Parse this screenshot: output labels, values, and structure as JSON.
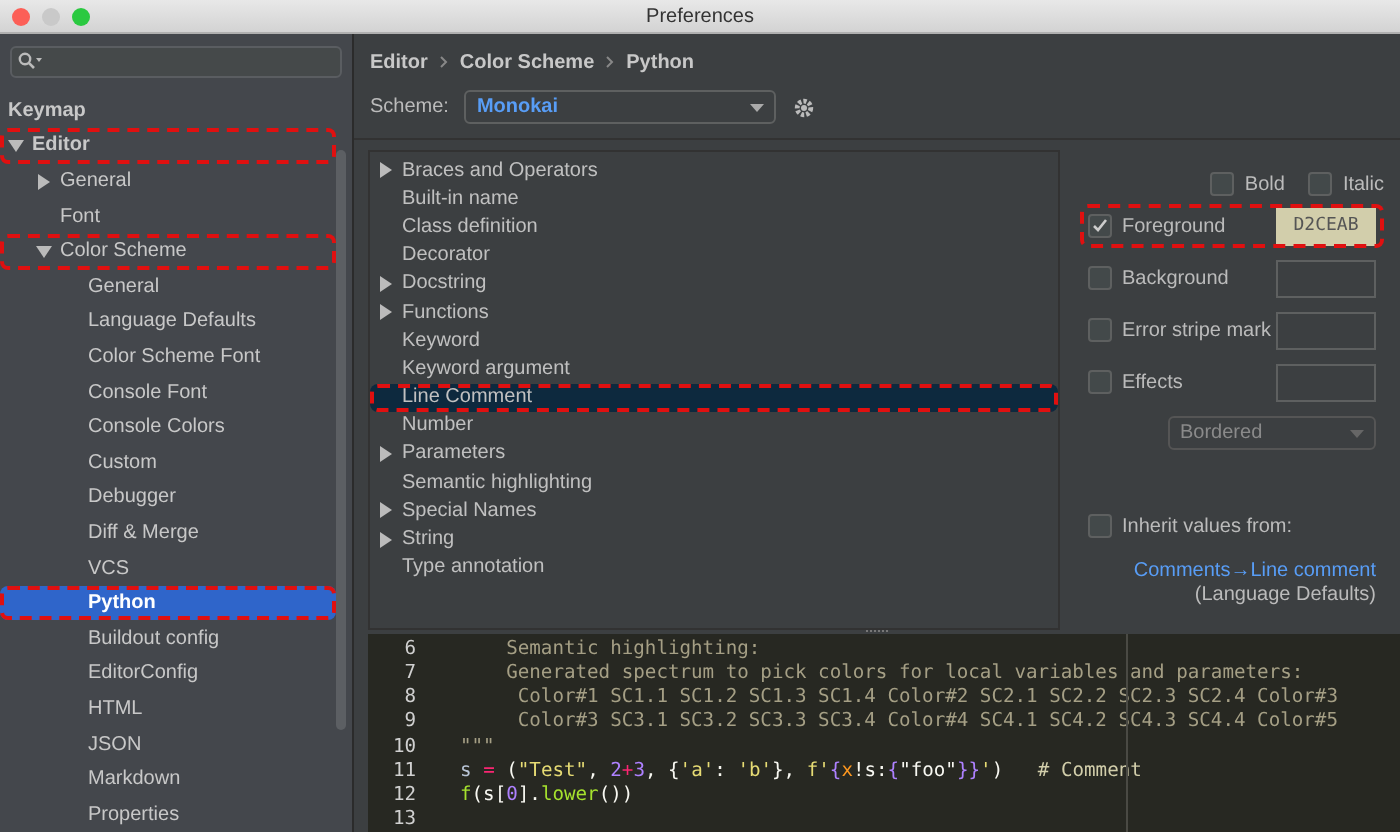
{
  "window": {
    "title": "Preferences"
  },
  "sidebar": {
    "items": [
      {
        "label": "Keymap",
        "selected": false,
        "annotated": false
      },
      {
        "label": "Editor",
        "selected": false,
        "annotated": true,
        "expanded": true,
        "children": [
          {
            "label": "General",
            "selected": false,
            "annotated": false,
            "expanded": false
          },
          {
            "label": "Font",
            "selected": false,
            "annotated": false
          },
          {
            "label": "Color Scheme",
            "selected": false,
            "annotated": true,
            "expanded": true,
            "children": [
              {
                "label": "General",
                "selected": false,
                "annotated": false
              },
              {
                "label": "Language Defaults",
                "selected": false,
                "annotated": false
              },
              {
                "label": "Color Scheme Font",
                "selected": false,
                "annotated": false
              },
              {
                "label": "Console Font",
                "selected": false,
                "annotated": false
              },
              {
                "label": "Console Colors",
                "selected": false,
                "annotated": false
              },
              {
                "label": "Custom",
                "selected": false,
                "annotated": false
              },
              {
                "label": "Debugger",
                "selected": false,
                "annotated": false
              },
              {
                "label": "Diff & Merge",
                "selected": false,
                "annotated": false
              },
              {
                "label": "VCS",
                "selected": false,
                "annotated": false
              },
              {
                "label": "Python",
                "selected": true,
                "annotated": true
              },
              {
                "label": "Buildout config",
                "selected": false,
                "annotated": false
              },
              {
                "label": "EditorConfig",
                "selected": false,
                "annotated": false
              },
              {
                "label": "HTML",
                "selected": false,
                "annotated": false
              },
              {
                "label": "JSON",
                "selected": false,
                "annotated": false
              },
              {
                "label": "Markdown",
                "selected": false,
                "annotated": false
              },
              {
                "label": "Properties",
                "selected": false,
                "annotated": false
              }
            ]
          }
        ]
      }
    ]
  },
  "breadcrumb": [
    "Editor",
    "Color Scheme",
    "Python"
  ],
  "scheme": {
    "label": "Scheme:",
    "value": "Monokai"
  },
  "attributes": [
    {
      "label": "Braces and Operators",
      "expanded": false,
      "selected": false,
      "annotated": false
    },
    {
      "label": "Built-in name",
      "selected": false,
      "annotated": false
    },
    {
      "label": "Class definition",
      "selected": false,
      "annotated": false
    },
    {
      "label": "Decorator",
      "selected": false,
      "annotated": false
    },
    {
      "label": "Docstring",
      "expanded": false,
      "selected": false,
      "annotated": false
    },
    {
      "label": "Functions",
      "expanded": false,
      "selected": false,
      "annotated": false
    },
    {
      "label": "Keyword",
      "selected": false,
      "annotated": false
    },
    {
      "label": "Keyword argument",
      "selected": false,
      "annotated": false
    },
    {
      "label": "Line Comment",
      "selected": true,
      "annotated": true
    },
    {
      "label": "Number",
      "selected": false,
      "annotated": false
    },
    {
      "label": "Parameters",
      "expanded": false,
      "selected": false,
      "annotated": false
    },
    {
      "label": "Semantic highlighting",
      "selected": false,
      "annotated": false
    },
    {
      "label": "Special Names",
      "expanded": false,
      "selected": false,
      "annotated": false
    },
    {
      "label": "String",
      "expanded": false,
      "selected": false,
      "annotated": false
    },
    {
      "label": "Type annotation",
      "selected": false,
      "annotated": false
    }
  ],
  "font_style": [
    {
      "label": "Bold",
      "checked": false
    },
    {
      "label": "Italic",
      "checked": false
    }
  ],
  "effects": [
    {
      "label": "Foreground",
      "checked": true,
      "value": "D2CEAB",
      "color": "#d2ceab",
      "annotated": true
    },
    {
      "label": "Background",
      "checked": false,
      "annotated": false
    },
    {
      "label": "Error stripe mark",
      "checked": false,
      "annotated": false
    },
    {
      "label": "Effects",
      "checked": false,
      "annotated": false
    }
  ],
  "effect_type": {
    "value": "Bordered",
    "disabled": true
  },
  "inherit": {
    "label": "Inherit values from:",
    "checked": false,
    "link": "Comments→Line comment",
    "note": "(Language Defaults)"
  },
  "code": [
    {
      "number": "6",
      "tokens": [
        {
          "text": "    Semantic highlighting:",
          "color": "#a59f85"
        }
      ]
    },
    {
      "number": "7",
      "tokens": [
        {
          "text": "    Generated spectrum to pick colors for local variables and parameters:",
          "color": "#a59f85"
        }
      ]
    },
    {
      "number": "8",
      "tokens": [
        {
          "text": "     Color#1 SC1.1 SC1.2 SC1.3 SC1.4 Color#2 SC2.1 SC2.2 SC2.3 SC2.4 Color#3",
          "color": "#a59f85"
        }
      ]
    },
    {
      "number": "9",
      "tokens": [
        {
          "text": "     Color#3 SC3.1 SC3.2 SC3.3 SC3.4 Color#4 SC4.1 SC4.2 SC4.3 SC4.4 Color#5",
          "color": "#a59f85"
        }
      ]
    },
    {
      "number": "10",
      "tokens": [
        {
          "text": "\"\"\"",
          "color": "#a59f85"
        }
      ]
    },
    {
      "number": "11",
      "tokens": [
        {
          "text": "s ",
          "color": "#b8c4d6"
        },
        {
          "text": "=",
          "color": "#f92672"
        },
        {
          "text": " (",
          "color": "#f8f8f2"
        },
        {
          "text": "\"Test\"",
          "color": "#e6db74"
        },
        {
          "text": ", ",
          "color": "#f8f8f2"
        },
        {
          "text": "2",
          "color": "#ae81ff"
        },
        {
          "text": "+",
          "color": "#f92672"
        },
        {
          "text": "3",
          "color": "#ae81ff"
        },
        {
          "text": ", {",
          "color": "#f8f8f2"
        },
        {
          "text": "'a'",
          "color": "#e6db74"
        },
        {
          "text": ": ",
          "color": "#f8f8f2"
        },
        {
          "text": "'b'",
          "color": "#e6db74"
        },
        {
          "text": "}, ",
          "color": "#f8f8f2"
        },
        {
          "text": "f'",
          "color": "#e6db74"
        },
        {
          "text": "{",
          "color": "#ae81ff"
        },
        {
          "text": "x",
          "color": "#fd971f"
        },
        {
          "text": "!s:",
          "color": "#f8f8f2"
        },
        {
          "text": "{",
          "color": "#ae81ff"
        },
        {
          "text": "\"foo\"",
          "color": "#f8f8f2"
        },
        {
          "text": "}}",
          "color": "#ae81ff"
        },
        {
          "text": "'",
          "color": "#e6db74"
        },
        {
          "text": ")   ",
          "color": "#f8f8f2"
        },
        {
          "text": "# Comment",
          "color": "#d2ceab"
        }
      ]
    },
    {
      "number": "12",
      "tokens": [
        {
          "text": "f",
          "color": "#a6e22e"
        },
        {
          "text": "(s[",
          "color": "#f8f8f2"
        },
        {
          "text": "0",
          "color": "#ae81ff"
        },
        {
          "text": "].",
          "color": "#f8f8f2"
        },
        {
          "text": "lower",
          "color": "#a6e22e"
        },
        {
          "text": "())",
          "color": "#f8f8f2"
        }
      ]
    },
    {
      "number": "13"
    }
  ]
}
